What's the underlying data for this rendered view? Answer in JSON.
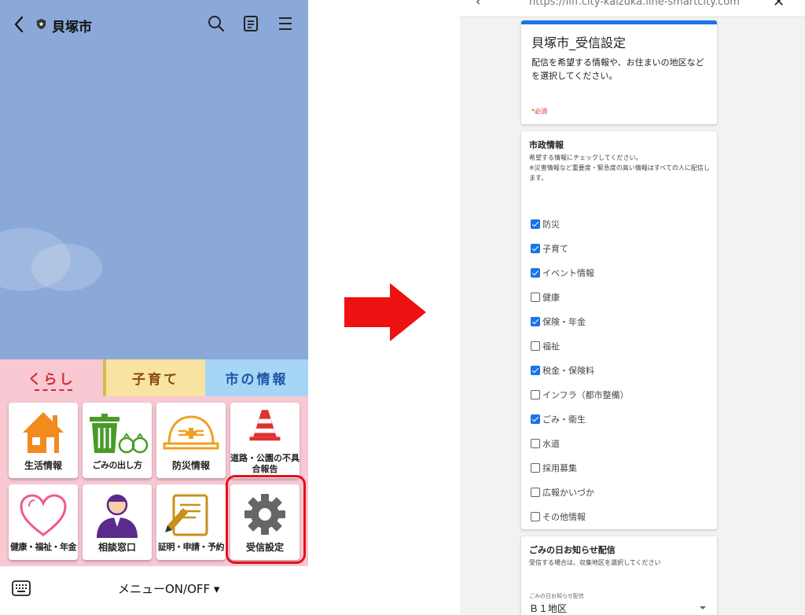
{
  "left_app": {
    "title": "貝塚市",
    "menu_tabs": [
      "くらし",
      "子育て",
      "市の情報"
    ],
    "menu_items": [
      {
        "label": "生活情報",
        "icon": "house-icon"
      },
      {
        "label": "ごみの出し方",
        "icon": "garbage-can-icon"
      },
      {
        "label": "防災情報",
        "icon": "helmet-icon"
      },
      {
        "label": "道路・公園の不具合報告",
        "icon": "traffic-cone-icon"
      },
      {
        "label": "健康・福祉・年金",
        "icon": "heart-icon"
      },
      {
        "label": "相談窓口",
        "icon": "person-icon"
      },
      {
        "label": "証明・申請・予約",
        "icon": "document-pen-icon"
      },
      {
        "label": "受信設定",
        "icon": "gear-icon"
      }
    ],
    "bottom_toggle": "メニューON/OFF ▾",
    "colors": {
      "chat_bg": "#8aa9d8",
      "menu_bg": "#f8c8d3",
      "highlight": "#e8101a"
    }
  },
  "right_app": {
    "url": "https://liff.city-kaizuka.line-smartcity.com",
    "form_title": "貝塚市_受信設定",
    "form_description": "配信を希望する情報や、お住まいの地区などを選択してください。",
    "required_note": "*必須",
    "section1": {
      "title": "市政情報",
      "description": "希望する情報にチェックしてください。\n※災害情報など重要度・緊急度の高い情報はすべての人に配信します。",
      "options": [
        {
          "label": "防災",
          "checked": true
        },
        {
          "label": "子育て",
          "checked": true
        },
        {
          "label": "イベント情報",
          "checked": true
        },
        {
          "label": "健康",
          "checked": false
        },
        {
          "label": "保険・年金",
          "checked": true
        },
        {
          "label": "福祉",
          "checked": false
        },
        {
          "label": "税金・保険料",
          "checked": true
        },
        {
          "label": "インフラ（都市整備）",
          "checked": false
        },
        {
          "label": "ごみ・衛生",
          "checked": true
        },
        {
          "label": "水道",
          "checked": false
        },
        {
          "label": "採用募集",
          "checked": false
        },
        {
          "label": "広報かいづか",
          "checked": false
        },
        {
          "label": "その他情報",
          "checked": false
        }
      ]
    },
    "section2": {
      "title": "ごみの日お知らせ配信",
      "description": "受信する場合は、収集地区を選択してください",
      "select_caption": "ごみの日お知らせ配信",
      "select_value": "Ｂ１地区"
    },
    "colors": {
      "accent": "#1a73e8",
      "required": "#d93025"
    }
  },
  "arrow_color": "#ee1111"
}
